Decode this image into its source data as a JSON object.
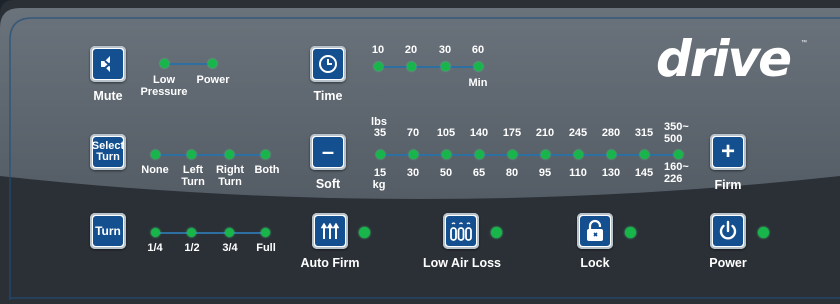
{
  "colors": {
    "panel_top": "#5f6770",
    "panel_bottom": "#2d3239",
    "button_blue": "#14508f",
    "led_green": "#18b64a",
    "track": "#2c6fa0"
  },
  "logo": {
    "text": "drive",
    "trademark": "™"
  },
  "mute": {
    "label": "Mute",
    "icon": "speaker-mute-icon"
  },
  "low_pressure": {
    "label": "Low\nPressure"
  },
  "power_indicator": {
    "label": "Power"
  },
  "time": {
    "label": "Time",
    "icon": "clock-icon",
    "options": [
      "10",
      "20",
      "30",
      "60"
    ],
    "unit": "Min"
  },
  "select_turn": {
    "label_line1": "Select",
    "label_line2": "Turn"
  },
  "turn_sides": [
    "None",
    "Left\nTurn",
    "Right\nTurn",
    "Both"
  ],
  "soft": {
    "label": "Soft",
    "symbol": "–"
  },
  "firm": {
    "label": "Firm",
    "symbol": "+"
  },
  "weights": {
    "lbs_unit": "lbs",
    "kg_unit": "kg",
    "lbs": [
      "35",
      "70",
      "105",
      "140",
      "175",
      "210",
      "245",
      "280",
      "315",
      "350~\n500"
    ],
    "kg": [
      "15",
      "30",
      "50",
      "65",
      "80",
      "95",
      "110",
      "130",
      "145",
      "160~\n226"
    ]
  },
  "turn": {
    "label": "Turn",
    "angles": [
      "1/4",
      "1/2",
      "3/4",
      "Full"
    ]
  },
  "auto_firm": {
    "label": "Auto Firm",
    "icon": "arrows-up-icon"
  },
  "low_air_loss": {
    "label": "Low Air Loss",
    "icon": "air-cells-icon"
  },
  "lock": {
    "label": "Lock",
    "icon": "padlock-icon"
  },
  "power": {
    "label": "Power",
    "icon": "power-icon"
  }
}
